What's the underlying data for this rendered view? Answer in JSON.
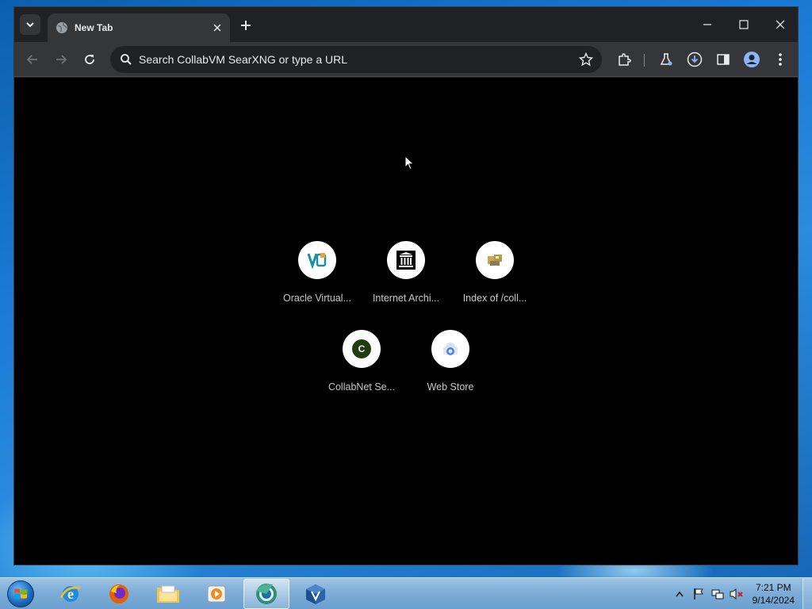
{
  "browser": {
    "tab": {
      "title": "New Tab",
      "favicon": "globe-icon"
    },
    "omnibox": {
      "placeholder": "Search CollabVM SearXNG or type a URL",
      "value": ""
    },
    "toolbar_icons": [
      "back-icon",
      "forward-icon",
      "reload-icon",
      "bookmark-star-icon",
      "extensions-icon",
      "labs-icon",
      "download-icon",
      "side-panel-icon",
      "profile-icon",
      "menu-icon"
    ]
  },
  "shortcuts": [
    {
      "label": "Oracle Virtual...",
      "icon": "virtualbox-icon"
    },
    {
      "label": "Internet Archi...",
      "icon": "archive-icon"
    },
    {
      "label": "Index of /coll...",
      "icon": "index-icon"
    },
    {
      "label": "CollabNet Se...",
      "icon": "collabnet-icon",
      "letter": "C"
    },
    {
      "label": "Web Store",
      "icon": "webstore-icon"
    }
  ],
  "taskbar": {
    "apps": [
      "internet-explorer-icon",
      "firefox-icon",
      "file-explorer-icon",
      "media-player-icon",
      "chrome-canary-icon",
      "virtualbox-icon"
    ],
    "clock": {
      "time": "7:21 PM",
      "date": "9/14/2024"
    }
  },
  "colors": {
    "window_bg": "#202124",
    "toolbar_bg": "#35363a",
    "content_bg": "#000000",
    "text": "#e8eaed",
    "taskbar": "#7eaed8"
  }
}
